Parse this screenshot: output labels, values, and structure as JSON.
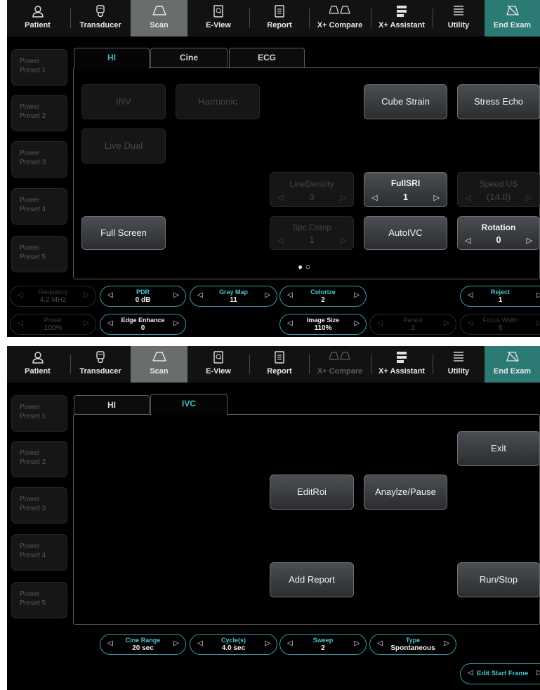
{
  "toolbar": {
    "patient": "Patient",
    "transducer": "Transducer",
    "scan": "Scan",
    "eview": "E-View",
    "report": "Report",
    "compare": "X+ Compare",
    "assistant": "X+ Assistant",
    "utility": "Utility",
    "end_exam": "End Exam"
  },
  "presets": [
    {
      "line1": "Power",
      "line2": "Preset 1"
    },
    {
      "line1": "Power",
      "line2": "Preset 2"
    },
    {
      "line1": "Power",
      "line2": "Preset 3"
    },
    {
      "line1": "Power",
      "line2": "Preset 4"
    },
    {
      "line1": "Power",
      "line2": "Preset 5"
    }
  ],
  "screen1": {
    "tabs": [
      "HI",
      "Cine",
      "ECG"
    ],
    "buttons": {
      "inv": "INV",
      "harmonic": "Harmonic",
      "live_dual": "Live Dual",
      "full_screen": "Full Screen",
      "cube_strain": "Cube Strain",
      "stress_echo": "Stress Echo",
      "auto_ivc": "AutoIVC"
    },
    "steppers": {
      "line_density": {
        "label": "LineDensity",
        "value": "3"
      },
      "fullsri": {
        "label": "FullSRI",
        "value": "1"
      },
      "speed_us": {
        "label": "Speed US",
        "value": "(14.0)"
      },
      "spc_comp": {
        "label": "Spc.Comp",
        "value": "1"
      },
      "rotation": {
        "label": "Rotation",
        "value": "0"
      }
    },
    "page_dots": "●   ○",
    "knobs": {
      "frequency": {
        "label": "Frequency",
        "value": "4.2 MHz"
      },
      "pdr": {
        "label": "PDR",
        "value": "0 dB"
      },
      "gray_map": {
        "label": "Gray Map",
        "value": "11"
      },
      "colorize": {
        "label": "Colorize",
        "value": "2"
      },
      "reject": {
        "label": "Reject",
        "value": "1"
      },
      "power": {
        "label": "Power",
        "value": "100%"
      },
      "edge_enhance": {
        "label": "Edge Enhance",
        "value": "0"
      },
      "image_size": {
        "label": "Image Size",
        "value": "110%"
      },
      "persist": {
        "label": "Persist",
        "value": "2"
      },
      "focus_width": {
        "label": "Focus Width",
        "value": "5"
      }
    }
  },
  "screen2": {
    "tabs": [
      "HI",
      "IVC"
    ],
    "buttons": {
      "exit": "Exit",
      "edit_roi": "EditRoi",
      "analyze": "Anaylze/Pause",
      "add_report": "Add Report",
      "run_stop": "Run/Stop"
    },
    "knobs": {
      "cine_range": {
        "label": "Cine Range",
        "value": "20 sec"
      },
      "cycles": {
        "label": "Cycle(s)",
        "value": "4.0 sec"
      },
      "sweep": {
        "label": "Sweep",
        "value": "2"
      },
      "type": {
        "label": "Type",
        "value": "Spontaneous"
      },
      "edit_start_frame": "Edit Start Frame"
    }
  },
  "colors": {
    "accent": "#41b9c6",
    "end_exam_bg": "#2c7a74",
    "active_toolbar_bg": "#6a6d6d"
  }
}
